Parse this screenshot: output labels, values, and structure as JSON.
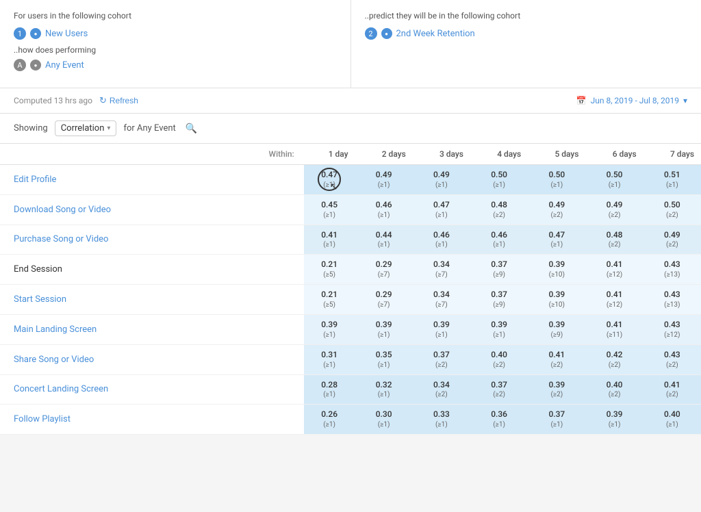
{
  "topLeft": {
    "label": "For users in the following cohort",
    "item1Num": "1",
    "item1Icon": "users-icon",
    "item1Link": "New Users",
    "performingLabel": "..how does performing",
    "itemANum": "A",
    "itemAIcon": "event-icon",
    "itemALink": "Any Event"
  },
  "topRight": {
    "label": "..predict they will be in the following cohort",
    "item2Num": "2",
    "item2Icon": "retention-icon",
    "item2Link": "2nd Week Retention"
  },
  "toolbar": {
    "computedText": "Computed 13 hrs ago",
    "refreshLabel": "Refresh",
    "dateRange": "Jun 8, 2019 - Jul 8, 2019"
  },
  "filterBar": {
    "showingLabel": "Showing",
    "dropdownLabel": "Correlation",
    "forLabel": "for Any Event"
  },
  "table": {
    "withinLabel": "Within:",
    "columns": [
      "1 day",
      "2 days",
      "3 days",
      "4 days",
      "5 days",
      "6 days",
      "7 days"
    ],
    "rows": [
      {
        "name": "Edit Profile",
        "isLink": true,
        "cells": [
          {
            "main": "0.47",
            "sub": "(≥1)",
            "shade": "shade-1",
            "highlighted": true
          },
          {
            "main": "0.49",
            "sub": "(≥1)",
            "shade": "shade-1"
          },
          {
            "main": "0.49",
            "sub": "(≥1)",
            "shade": "shade-1"
          },
          {
            "main": "0.50",
            "sub": "(≥1)",
            "shade": "shade-1"
          },
          {
            "main": "0.50",
            "sub": "(≥1)",
            "shade": "shade-1"
          },
          {
            "main": "0.50",
            "sub": "(≥1)",
            "shade": "shade-1"
          },
          {
            "main": "0.51",
            "sub": "(≥1)",
            "shade": "shade-1"
          }
        ]
      },
      {
        "name": "Download Song or Video",
        "isLink": true,
        "cells": [
          {
            "main": "0.45",
            "sub": "(≥1)",
            "shade": "shade-light1"
          },
          {
            "main": "0.46",
            "sub": "(≥1)",
            "shade": "shade-light1"
          },
          {
            "main": "0.47",
            "sub": "(≥1)",
            "shade": "shade-light1"
          },
          {
            "main": "0.48",
            "sub": "(≥2)",
            "shade": "shade-light1"
          },
          {
            "main": "0.49",
            "sub": "(≥2)",
            "shade": "shade-light1"
          },
          {
            "main": "0.49",
            "sub": "(≥2)",
            "shade": "shade-light1"
          },
          {
            "main": "0.50",
            "sub": "(≥2)",
            "shade": "shade-light1"
          }
        ]
      },
      {
        "name": "Purchase Song or Video",
        "isLink": true,
        "cells": [
          {
            "main": "0.41",
            "sub": "(≥1)",
            "shade": "shade-light2"
          },
          {
            "main": "0.44",
            "sub": "(≥1)",
            "shade": "shade-light2"
          },
          {
            "main": "0.46",
            "sub": "(≥1)",
            "shade": "shade-light2"
          },
          {
            "main": "0.46",
            "sub": "(≥1)",
            "shade": "shade-light2"
          },
          {
            "main": "0.47",
            "sub": "(≥1)",
            "shade": "shade-light2"
          },
          {
            "main": "0.48",
            "sub": "(≥2)",
            "shade": "shade-light2"
          },
          {
            "main": "0.49",
            "sub": "(≥2)",
            "shade": "shade-light2"
          }
        ]
      },
      {
        "name": "End Session",
        "isLink": false,
        "cells": [
          {
            "main": "0.21",
            "sub": "(≥5)",
            "shade": "shade-low1"
          },
          {
            "main": "0.29",
            "sub": "(≥7)",
            "shade": "shade-low1"
          },
          {
            "main": "0.34",
            "sub": "(≥7)",
            "shade": "shade-low1"
          },
          {
            "main": "0.37",
            "sub": "(≥9)",
            "shade": "shade-low1"
          },
          {
            "main": "0.39",
            "sub": "(≥10)",
            "shade": "shade-low1"
          },
          {
            "main": "0.41",
            "sub": "(≥12)",
            "shade": "shade-low1"
          },
          {
            "main": "0.43",
            "sub": "(≥13)",
            "shade": "shade-low1"
          }
        ]
      },
      {
        "name": "Start Session",
        "isLink": true,
        "cells": [
          {
            "main": "0.21",
            "sub": "(≥5)",
            "shade": "shade-low1"
          },
          {
            "main": "0.29",
            "sub": "(≥7)",
            "shade": "shade-low1"
          },
          {
            "main": "0.34",
            "sub": "(≥7)",
            "shade": "shade-low1"
          },
          {
            "main": "0.37",
            "sub": "(≥9)",
            "shade": "shade-low1"
          },
          {
            "main": "0.39",
            "sub": "(≥10)",
            "shade": "shade-low1"
          },
          {
            "main": "0.41",
            "sub": "(≥12)",
            "shade": "shade-low1"
          },
          {
            "main": "0.43",
            "sub": "(≥13)",
            "shade": "shade-low1"
          }
        ]
      },
      {
        "name": "Main Landing Screen",
        "isLink": true,
        "cells": [
          {
            "main": "0.39",
            "sub": "(≥1)",
            "shade": "shade-low2"
          },
          {
            "main": "0.39",
            "sub": "(≥1)",
            "shade": "shade-low2"
          },
          {
            "main": "0.39",
            "sub": "(≥1)",
            "shade": "shade-low2"
          },
          {
            "main": "0.39",
            "sub": "(≥1)",
            "shade": "shade-low2"
          },
          {
            "main": "0.39",
            "sub": "(≥9)",
            "shade": "shade-low2"
          },
          {
            "main": "0.41",
            "sub": "(≥11)",
            "shade": "shade-low2"
          },
          {
            "main": "0.43",
            "sub": "(≥12)",
            "shade": "shade-low2"
          }
        ]
      },
      {
        "name": "Share Song or Video",
        "isLink": true,
        "cells": [
          {
            "main": "0.31",
            "sub": "(≥1)",
            "shade": "shade-low3"
          },
          {
            "main": "0.35",
            "sub": "(≥1)",
            "shade": "shade-low3"
          },
          {
            "main": "0.37",
            "sub": "(≥2)",
            "shade": "shade-low3"
          },
          {
            "main": "0.40",
            "sub": "(≥2)",
            "shade": "shade-low3"
          },
          {
            "main": "0.41",
            "sub": "(≥2)",
            "shade": "shade-low3"
          },
          {
            "main": "0.42",
            "sub": "(≥2)",
            "shade": "shade-low3"
          },
          {
            "main": "0.43",
            "sub": "(≥2)",
            "shade": "shade-low3"
          }
        ]
      },
      {
        "name": "Concert Landing Screen",
        "isLink": true,
        "cells": [
          {
            "main": "0.28",
            "sub": "(≥1)",
            "shade": "shade-low4"
          },
          {
            "main": "0.32",
            "sub": "(≥1)",
            "shade": "shade-low4"
          },
          {
            "main": "0.34",
            "sub": "(≥2)",
            "shade": "shade-low4"
          },
          {
            "main": "0.37",
            "sub": "(≥2)",
            "shade": "shade-low4"
          },
          {
            "main": "0.39",
            "sub": "(≥2)",
            "shade": "shade-low4"
          },
          {
            "main": "0.40",
            "sub": "(≥2)",
            "shade": "shade-low4"
          },
          {
            "main": "0.41",
            "sub": "(≥2)",
            "shade": "shade-low4"
          }
        ]
      },
      {
        "name": "Follow Playlist",
        "isLink": true,
        "cells": [
          {
            "main": "0.26",
            "sub": "(≥1)",
            "shade": "shade-low4"
          },
          {
            "main": "0.30",
            "sub": "(≥1)",
            "shade": "shade-low4"
          },
          {
            "main": "0.33",
            "sub": "(≥1)",
            "shade": "shade-low4"
          },
          {
            "main": "0.36",
            "sub": "(≥1)",
            "shade": "shade-low4"
          },
          {
            "main": "0.37",
            "sub": "(≥1)",
            "shade": "shade-low4"
          },
          {
            "main": "0.39",
            "sub": "(≥1)",
            "shade": "shade-low4"
          },
          {
            "main": "0.40",
            "sub": "(≥1)",
            "shade": "shade-low4"
          }
        ]
      }
    ]
  }
}
